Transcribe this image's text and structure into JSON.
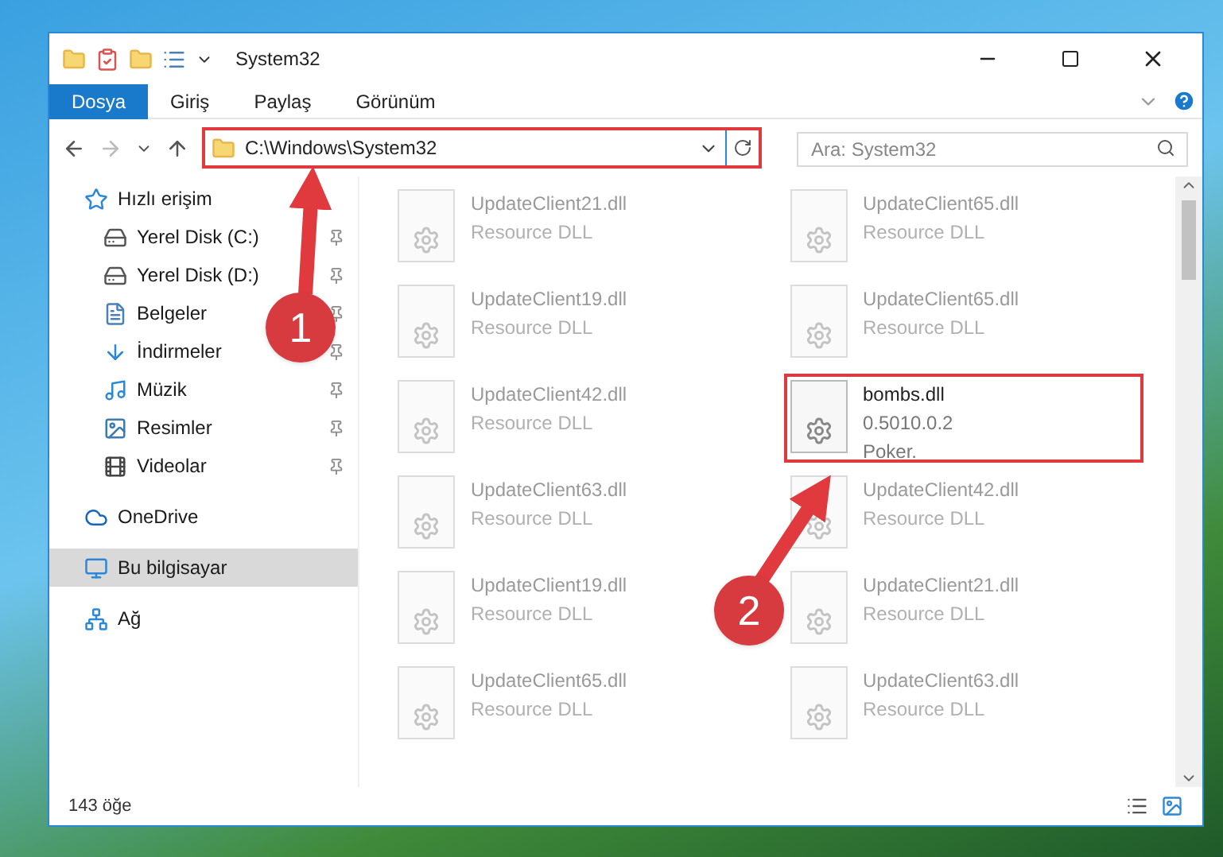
{
  "window": {
    "title": "System32"
  },
  "ribbon": {
    "tabs": [
      {
        "label": "Dosya",
        "selected": true
      },
      {
        "label": "Giriş",
        "selected": false
      },
      {
        "label": "Paylaş",
        "selected": false
      },
      {
        "label": "Görünüm",
        "selected": false
      }
    ]
  },
  "address_bar": {
    "path": "C:\\Windows\\System32",
    "highlighted": true
  },
  "search": {
    "placeholder": "Ara: System32"
  },
  "sidebar": {
    "items": [
      {
        "label": "Hızlı erişim",
        "kind": "star",
        "selected": false,
        "children": [
          {
            "label": "Yerel Disk (C:)",
            "kind": "drive",
            "selected": false,
            "pinned": true
          },
          {
            "label": "Yerel Disk (D:)",
            "kind": "drive",
            "selected": false,
            "pinned": true
          },
          {
            "label": "Belgeler",
            "kind": "documents",
            "selected": false,
            "pinned": true
          },
          {
            "label": "İndirmeler",
            "kind": "downloads",
            "selected": false,
            "pinned": true
          },
          {
            "label": "Müzik",
            "kind": "music",
            "selected": false,
            "pinned": true
          },
          {
            "label": "Resimler",
            "kind": "pictures",
            "selected": false,
            "pinned": true
          },
          {
            "label": "Videolar",
            "kind": "videos",
            "selected": false,
            "pinned": true
          }
        ]
      },
      {
        "label": "OneDrive",
        "kind": "cloud",
        "selected": false
      },
      {
        "label": "Bu bilgisayar",
        "kind": "pc",
        "selected": true
      },
      {
        "label": "Ağ",
        "kind": "network",
        "selected": false
      }
    ]
  },
  "files": [
    {
      "name": "UpdateClient21.dll",
      "details": [
        "Resource DLL"
      ],
      "dimmed": true,
      "highlighted": false
    },
    {
      "name": "UpdateClient65.dll",
      "details": [
        "Resource DLL"
      ],
      "dimmed": true,
      "highlighted": false
    },
    {
      "name": "UpdateClient19.dll",
      "details": [
        "Resource DLL"
      ],
      "dimmed": true,
      "highlighted": false
    },
    {
      "name": "UpdateClient65.dll",
      "details": [
        "Resource DLL"
      ],
      "dimmed": true,
      "highlighted": false
    },
    {
      "name": "UpdateClient42.dll",
      "details": [
        "Resource DLL"
      ],
      "dimmed": true,
      "highlighted": false
    },
    {
      "name": "bombs.dll",
      "details": [
        "0.5010.0.2",
        "Poker."
      ],
      "dimmed": false,
      "highlighted": true
    },
    {
      "name": "UpdateClient63.dll",
      "details": [
        "Resource DLL"
      ],
      "dimmed": true,
      "highlighted": false
    },
    {
      "name": "UpdateClient42.dll",
      "details": [
        "Resource DLL"
      ],
      "dimmed": true,
      "highlighted": false
    },
    {
      "name": "UpdateClient19.dll",
      "details": [
        "Resource DLL"
      ],
      "dimmed": true,
      "highlighted": false
    },
    {
      "name": "UpdateClient21.dll",
      "details": [
        "Resource DLL"
      ],
      "dimmed": true,
      "highlighted": false
    },
    {
      "name": "UpdateClient65.dll",
      "details": [
        "Resource DLL"
      ],
      "dimmed": true,
      "highlighted": false
    },
    {
      "name": "UpdateClient63.dll",
      "details": [
        "Resource DLL"
      ],
      "dimmed": true,
      "highlighted": false
    }
  ],
  "status_bar": {
    "count": "143 öğe"
  },
  "annotations": [
    {
      "label": "1"
    },
    {
      "label": "2"
    }
  ]
}
